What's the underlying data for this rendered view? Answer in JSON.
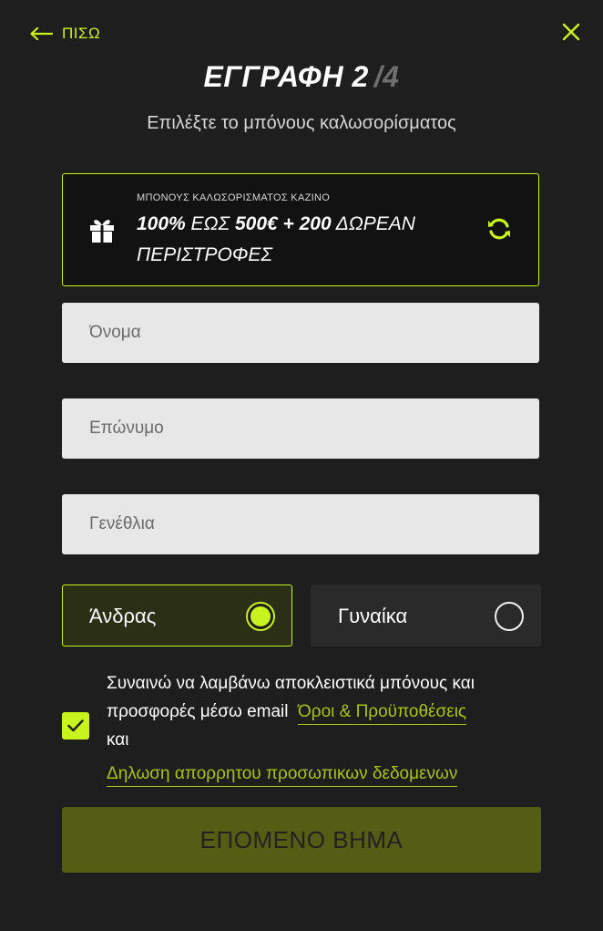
{
  "header": {
    "back_label": "ΠΙΣΩ",
    "title": "ΕΓΓΡΑΦΗ",
    "step_current": "2",
    "step_total": "/4",
    "subtitle": "Επιλέξτε το μπόνους καλωσορίσματος"
  },
  "bonus": {
    "label": "ΜΠΟΝΟΥΣ ΚΑΛΩΣΟΡΙΣΜΑΤΟΣ ΚΑΖΙΝΟ",
    "headline_pct": "100%",
    "headline_mid": " ΕΩΣ ",
    "headline_amount": "500€ + 200",
    "headline_tail": " ΔΩΡΕΑΝ ΠΕΡΙΣΤΡΟΦΕΣ"
  },
  "form": {
    "first_name_placeholder": "Όνομα",
    "last_name_placeholder": "Επώνυμο",
    "birthday_placeholder": "Γενέθλια"
  },
  "gender": {
    "male_label": "Άνδρας",
    "female_label": "Γυναίκα",
    "selected": "male"
  },
  "consent": {
    "checked": true,
    "text_line1": "Συναινώ να λαμβάνω αποκλειστικά μπόνους και",
    "text_line2": "προσφορές μέσω email",
    "terms_link": "Όροι & Προϋποθέσεις",
    "and_word": "και",
    "privacy_link": "Δηλωση απορρητου προσωπικων δεδομενων"
  },
  "next_button_label": "ΕΠΟΜΕΝΟ ΒΗΜΑ",
  "icons": {
    "back": "arrow-left-icon",
    "close": "close-icon",
    "gift": "gift-icon",
    "refresh": "refresh-icon",
    "check": "checkmark-icon"
  },
  "colors": {
    "accent": "#c9f31d",
    "background": "#1e1e1e",
    "button": "#535d14",
    "link": "#a8c41a"
  }
}
